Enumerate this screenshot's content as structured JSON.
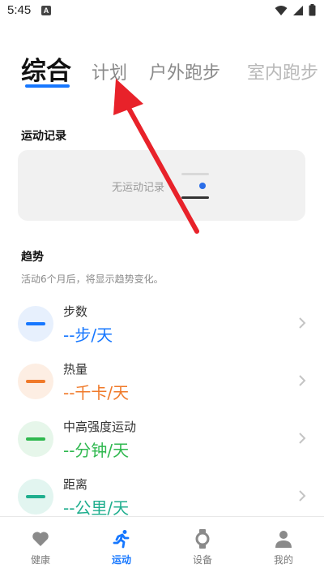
{
  "status_bar": {
    "time": "5:45",
    "notification_icon": "A"
  },
  "tabs": [
    {
      "label": "综合",
      "active": true
    },
    {
      "label": "计划",
      "active": false
    },
    {
      "label": "户外跑步",
      "active": false
    },
    {
      "label": "室内跑步",
      "active": false
    }
  ],
  "records": {
    "title": "运动记录",
    "empty_text": "无运动记录"
  },
  "trend": {
    "title": "趋势",
    "subtitle": "活动6个月后，将显示趋势变化。"
  },
  "metrics": [
    {
      "label": "步数",
      "value": "--步/天",
      "color": "#1677ff",
      "bg": "#e7f0fd",
      "icon": "steps-icon"
    },
    {
      "label": "热量",
      "value": "--千卡/天",
      "color": "#f07a2a",
      "bg": "#fdeee3",
      "icon": "calories-icon"
    },
    {
      "label": "中高强度运动",
      "value": "--分钟/天",
      "color": "#2fb84f",
      "bg": "#e6f6ea",
      "icon": "intensity-icon"
    },
    {
      "label": "距离",
      "value": "--公里/天",
      "color": "#1fae8e",
      "bg": "#e2f5f0",
      "icon": "distance-icon"
    }
  ],
  "nav": {
    "health": "健康",
    "exercise": "运动",
    "device": "设备",
    "mine": "我的",
    "active_color": "#1677ff",
    "inactive_color": "#7a7a7a"
  },
  "annotation": {
    "arrow_color": "#e8222a"
  }
}
